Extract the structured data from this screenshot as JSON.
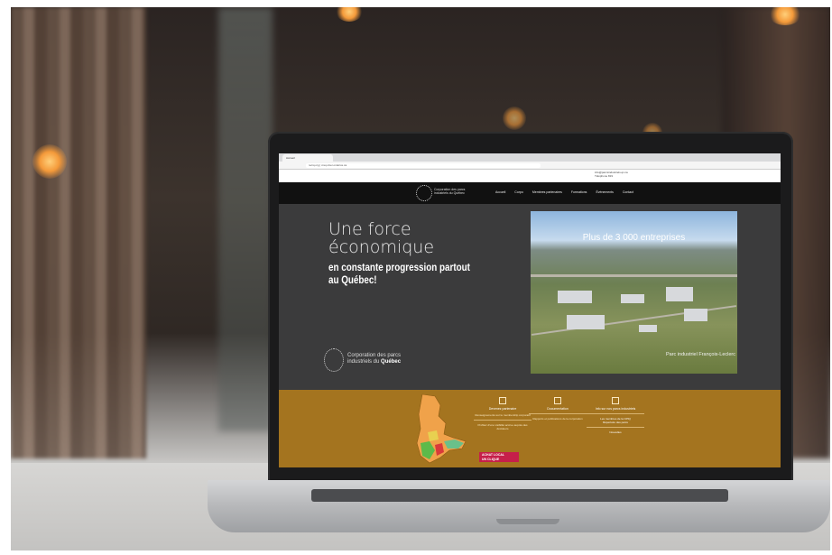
{
  "browser": {
    "tab_title": "Accueil",
    "url": "reciq.org  |  creq-inter.ontarios.ca"
  },
  "site": {
    "top_contact": "info@parcsindustriels.qc.ca",
    "top_contact_2": "Téléphone 819",
    "logo_text": "Corporation des parcs industriels du Québec",
    "nav": [
      "Accueil",
      "Corpo",
      "Membres partenaires",
      "Formations",
      "Événements",
      "Contact"
    ],
    "hero_title_light": "Une force économique",
    "hero_title_bold": "en constante progression partout au Québec!",
    "hero_logo_line1": "Corporation des parcs",
    "hero_logo_line2": "industriels du",
    "hero_logo_line3": "Québec",
    "hero_photo_title": "Plus de 3 000 entreprises",
    "hero_photo_caption": "Parc industriel François-Leclerc",
    "band": {
      "col1_title": "Devenez partenaire",
      "col1_text": "Renseignements sur le membership corporatif",
      "col1_text2": "Profitez d'une visibilité accrue auprès des décideurs",
      "col2_title": "Documentation",
      "col2_text": "Rapports et publications de la corporation",
      "col3_title": "Info sur nos parcs industriels",
      "col3_link1": "Les membres de la CPIQ",
      "col3_link2": "Répertoire des parcs",
      "col3_link3": "Nouvelles",
      "achat_line1": "ACHAT LOCAL",
      "achat_line2": "UN CLIQUE"
    }
  }
}
